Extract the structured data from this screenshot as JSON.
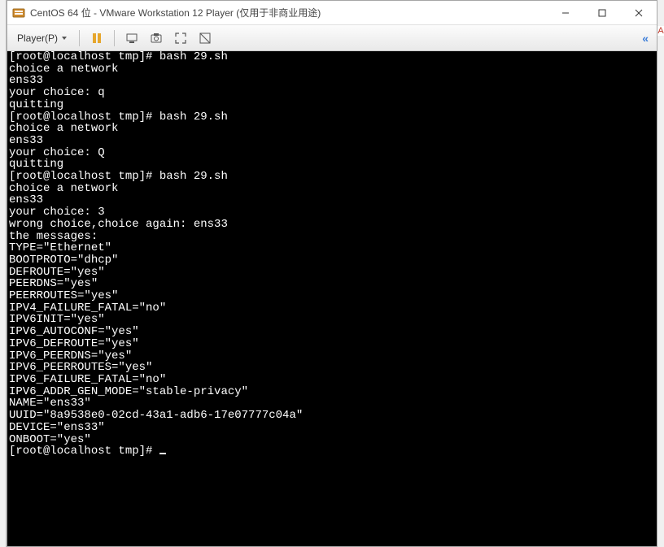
{
  "titlebar": {
    "title": "CentOS 64 位 - VMware Workstation 12 Player (仅用于非商业用途)"
  },
  "toolbar": {
    "player_label": "Player(P)"
  },
  "terminal": {
    "lines": [
      "[root@localhost tmp]# bash 29.sh",
      "choice a network",
      "ens33",
      "your choice: q",
      "quitting",
      "[root@localhost tmp]# bash 29.sh",
      "choice a network",
      "ens33",
      "your choice: Q",
      "quitting",
      "[root@localhost tmp]# bash 29.sh",
      "choice a network",
      "ens33",
      "your choice: 3",
      "wrong choice,choice again: ens33",
      "the messages:",
      "TYPE=\"Ethernet\"",
      "BOOTPROTO=\"dhcp\"",
      "DEFROUTE=\"yes\"",
      "PEERDNS=\"yes\"",
      "PEERROUTES=\"yes\"",
      "IPV4_FAILURE_FATAL=\"no\"",
      "IPV6INIT=\"yes\"",
      "IPV6_AUTOCONF=\"yes\"",
      "IPV6_DEFROUTE=\"yes\"",
      "IPV6_PEERDNS=\"yes\"",
      "IPV6_PEERROUTES=\"yes\"",
      "IPV6_FAILURE_FATAL=\"no\"",
      "IPV6_ADDR_GEN_MODE=\"stable-privacy\"",
      "NAME=\"ens33\"",
      "UUID=\"8a9538e0-02cd-43a1-adb6-17e07777c04a\"",
      "DEVICE=\"ens33\"",
      "ONBOOT=\"yes\"",
      "[root@localhost tmp]# "
    ]
  },
  "rightMark": "A"
}
